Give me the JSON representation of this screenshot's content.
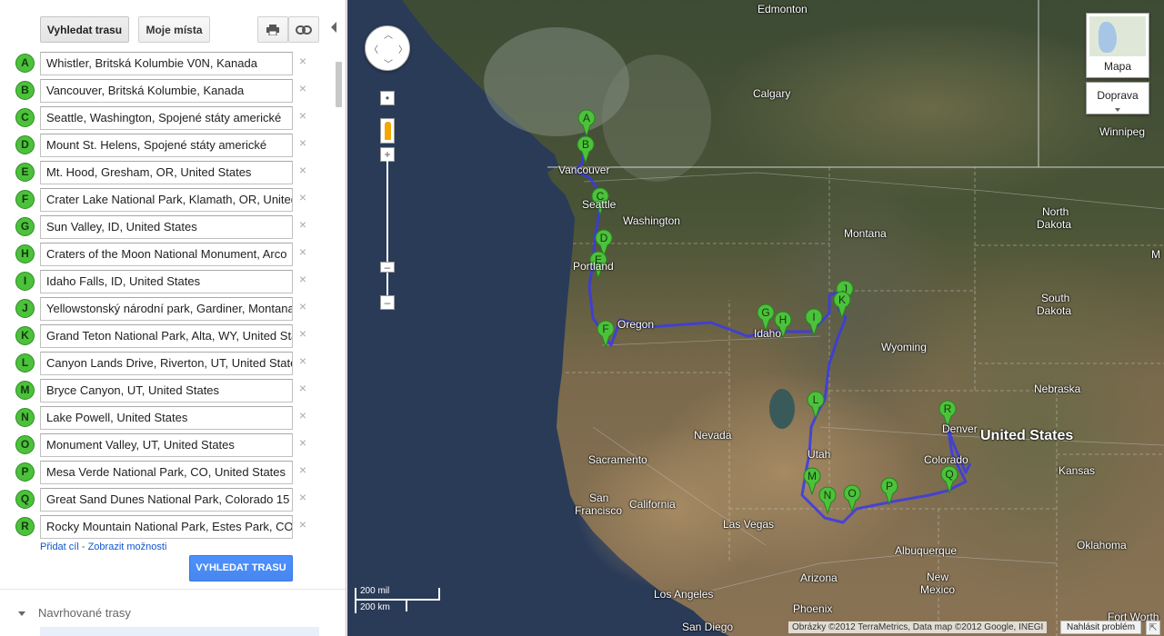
{
  "toolbar": {
    "directions_tab": "Vyhledat trasu",
    "my_places_tab": "Moje místa",
    "print_icon": "print-icon",
    "link_icon": "link-icon"
  },
  "waypoints": [
    {
      "letter": "A",
      "value": "Whistler, Britská Kolumbie V0N, Kanada"
    },
    {
      "letter": "B",
      "value": "Vancouver, Britská Kolumbie, Kanada"
    },
    {
      "letter": "C",
      "value": "Seattle, Washington, Spojené státy americké"
    },
    {
      "letter": "D",
      "value": "Mount St. Helens, Spojené státy americké"
    },
    {
      "letter": "E",
      "value": "Mt. Hood, Gresham, OR, United States"
    },
    {
      "letter": "F",
      "value": "Crater Lake National Park, Klamath, OR, United States"
    },
    {
      "letter": "G",
      "value": "Sun Valley, ID, United States"
    },
    {
      "letter": "H",
      "value": "Craters of the Moon National Monument, Arco"
    },
    {
      "letter": "I",
      "value": "Idaho Falls, ID, United States"
    },
    {
      "letter": "J",
      "value": "Yellowstonský národní park, Gardiner, Montana"
    },
    {
      "letter": "K",
      "value": "Grand Teton National Park, Alta, WY, United States"
    },
    {
      "letter": "L",
      "value": "Canyon Lands Drive, Riverton, UT, United States"
    },
    {
      "letter": "M",
      "value": "Bryce Canyon, UT, United States"
    },
    {
      "letter": "N",
      "value": "Lake Powell, United States"
    },
    {
      "letter": "O",
      "value": "Monument Valley, UT, United States"
    },
    {
      "letter": "P",
      "value": "Mesa Verde National Park, CO, United States"
    },
    {
      "letter": "Q",
      "value": "Great Sand Dunes National Park, Colorado 15"
    },
    {
      "letter": "R",
      "value": "Rocky Mountain National Park, Estes Park, CO"
    }
  ],
  "remove_symbol": "×",
  "links": {
    "add_destination": "Přidat cíl",
    "separator": " - ",
    "show_options": "Zobrazit možnosti"
  },
  "search_button": "VYHLEDAT TRASU",
  "suggested_routes": "Navrhované trasy",
  "map": {
    "labels": {
      "edmonton": "Edmonton",
      "calgary": "Calgary",
      "winnipeg": "Winnipeg",
      "vancouver": "Vancouver",
      "seattle": "Seattle",
      "washington": "Washington",
      "montana": "Montana",
      "north_dakota_1": "North",
      "north_dakota_2": "Dakota",
      "south_dakota_1": "South",
      "south_dakota_2": "Dakota",
      "portland": "Portland",
      "oregon": "Oregon",
      "idaho": "Idaho",
      "wyoming": "Wyoming",
      "nebraska": "Nebraska",
      "nevada": "Nevada",
      "utah": "Utah",
      "denver": "Denver",
      "united_states": "United States",
      "colorado": "Colorado",
      "kansas": "Kansas",
      "sacramento": "Sacramento",
      "san_francisco_1": "San",
      "san_francisco_2": "Francisco",
      "california": "California",
      "las_vegas": "Las Vegas",
      "albuquerque": "Albuquerque",
      "oklahoma": "Oklahoma",
      "arizona": "Arizona",
      "los_angeles": "Los Angeles",
      "new_mexico_1": "New",
      "new_mexico_2": "Mexico",
      "phoenix": "Phoenix",
      "san_diego": "San Diego",
      "fort_worth": "Fort Worth",
      "edge_m": "M"
    },
    "map_type": "Mapa",
    "traffic": "Doprava",
    "scale_mi": "200 mil",
    "scale_km": "200 km",
    "attribution": "Obrázky ©2012 TerraMetrics, Data map ©2012 Google, INEGI",
    "report_problem": "Nahlásit problém"
  },
  "colors": {
    "route": "#3a3ae8",
    "marker_fill": "#4cc13b",
    "primary_button": "#4d90fe"
  }
}
